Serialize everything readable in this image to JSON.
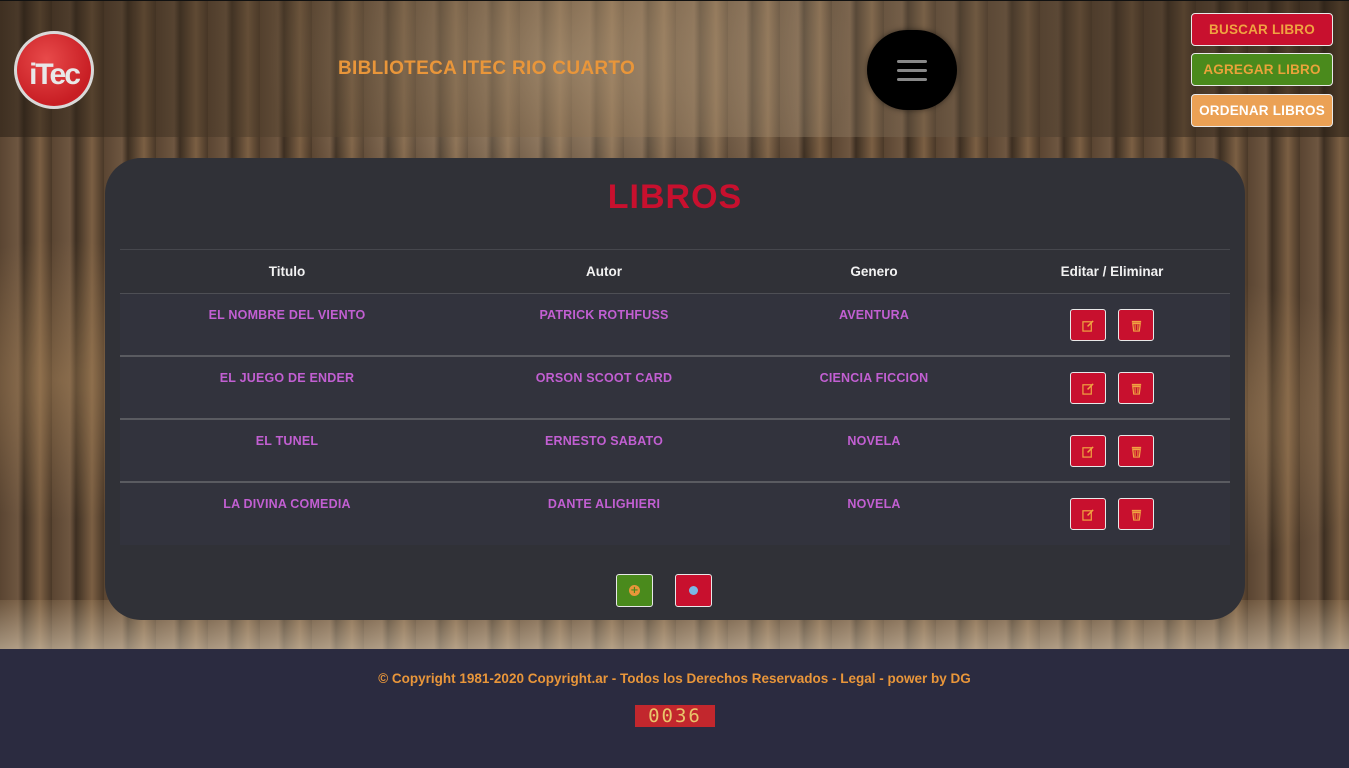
{
  "header": {
    "logo_text": "iTec",
    "site_title": "BIBLIOTECA ITEC RIO CUARTO",
    "menu_icon": "hamburger-icon",
    "buttons": {
      "buscar": "BUSCAR LIBRO",
      "agregar": "AGREGAR LIBRO",
      "ordenar": "ORDENAR LIBROS"
    }
  },
  "main": {
    "title": "LIBROS",
    "table": {
      "headers": [
        "Titulo",
        "Autor",
        "Genero",
        "Editar / Eliminar"
      ],
      "rows": [
        {
          "titulo": "EL NOMBRE DEL VIENTO",
          "autor": "PATRICK ROTHFUSS",
          "genero": "AVENTURA"
        },
        {
          "titulo": "EL JUEGO DE ENDER",
          "autor": "ORSON SCOOT CARD",
          "genero": "CIENCIA FICCION"
        },
        {
          "titulo": "EL TUNEL",
          "autor": "ERNESTO SABATO",
          "genero": "NOVELA"
        },
        {
          "titulo": "LA DIVINA COMEDIA",
          "autor": "DANTE ALIGHIERI",
          "genero": "NOVELA"
        }
      ]
    }
  },
  "footer": {
    "copyright": "© Copyright 1981-2020 Copyright.ar - Todos los Derechos Reservados - Legal - power by DG",
    "counter": "0036"
  },
  "colors": {
    "brand_red": "#c8102e",
    "brand_orange": "#e9963a",
    "brand_green": "#4a8a1c",
    "cell_text": "#c25fd2",
    "panel": "#303137",
    "footer": "#2b2b40"
  }
}
